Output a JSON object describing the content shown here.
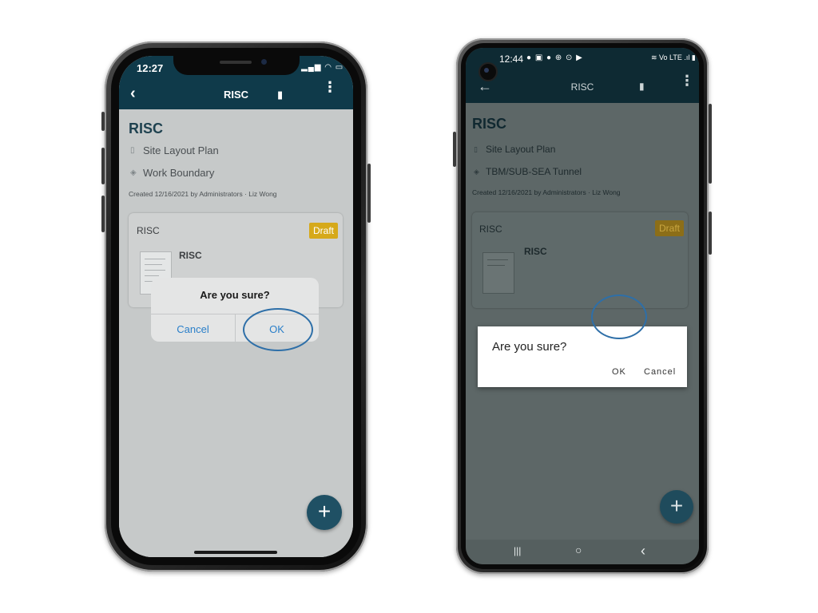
{
  "ios": {
    "time": "12:27",
    "status_icons": "▂▄▆ ◠ ▭",
    "nav": {
      "back_icon": "‹",
      "title": "RISC",
      "map_icon": "▮",
      "more_icon": "⋮"
    },
    "title": "RISC",
    "rows": [
      {
        "icon": "▯",
        "label": "Site Layout Plan"
      },
      {
        "icon": "◈",
        "label": "Work Boundary"
      }
    ],
    "created": "Created 12/16/2021 by Administrators · Liz Wong",
    "card": {
      "title": "RISC",
      "badge": "Draft",
      "doc_title": "RISC"
    },
    "alert": {
      "title": "Are you sure?",
      "cancel": "Cancel",
      "ok": "OK"
    },
    "fab": "+"
  },
  "android": {
    "time": "12:44",
    "status_icons": "● ▣ ● ⊕ ⊙ ▶",
    "status_right": "≋ Vo LTE .ıl ▮",
    "nav": {
      "back_icon": "←",
      "title": "RISC",
      "map_icon": "▮",
      "more_icon": "⋮"
    },
    "title": "RISC",
    "rows": [
      {
        "icon": "▯",
        "label": "Site Layout Plan"
      },
      {
        "icon": "◈",
        "label": "TBM/SUB-SEA Tunnel"
      }
    ],
    "created": "Created 12/16/2021 by Administrators · Liz Wong",
    "card": {
      "title": "RISC",
      "badge": "Draft",
      "doc_title": "RISC"
    },
    "dialog": {
      "title": "Are you sure?",
      "ok": "OK",
      "cancel": "Cancel"
    },
    "fab": "+",
    "navbar": {
      "recent": "|||",
      "home": "○",
      "back": "‹"
    }
  },
  "colors": {
    "app_bar": "#0f3a4a",
    "accent_link": "#2a7fc9",
    "draft_badge": "#d6a91a",
    "highlight_ring": "#2e6fa8",
    "fab": "#1f5064"
  }
}
